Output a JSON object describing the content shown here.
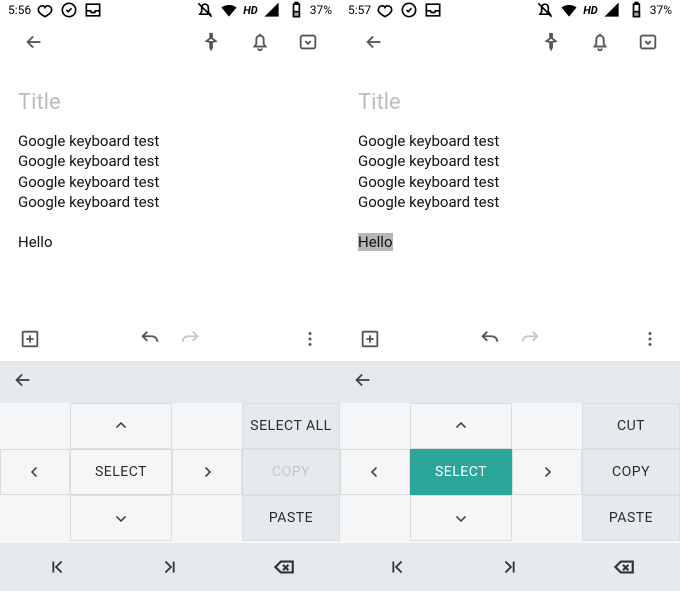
{
  "left": {
    "status": {
      "time": "5:56",
      "hd": "HD",
      "battery": "37%"
    },
    "title_placeholder": "Title",
    "lines": {
      "l1": "Google keyboard test",
      "l2": "Google keyboard test",
      "l3": "Google keyboard test",
      "l4": "Google keyboard test",
      "l5": "Hello"
    },
    "kb": {
      "select": "SELECT",
      "select_all": "SELECT ALL",
      "copy": "COPY",
      "paste": "PASTE"
    }
  },
  "right": {
    "status": {
      "time": "5:57",
      "hd": "HD",
      "battery": "37%"
    },
    "title_placeholder": "Title",
    "lines": {
      "l1": "Google keyboard test",
      "l2": "Google keyboard test",
      "l3": "Google keyboard test",
      "l4": "Google keyboard test",
      "l5": "Hello"
    },
    "kb": {
      "select": "SELECT",
      "cut": "CUT",
      "copy": "COPY",
      "paste": "PASTE"
    }
  }
}
